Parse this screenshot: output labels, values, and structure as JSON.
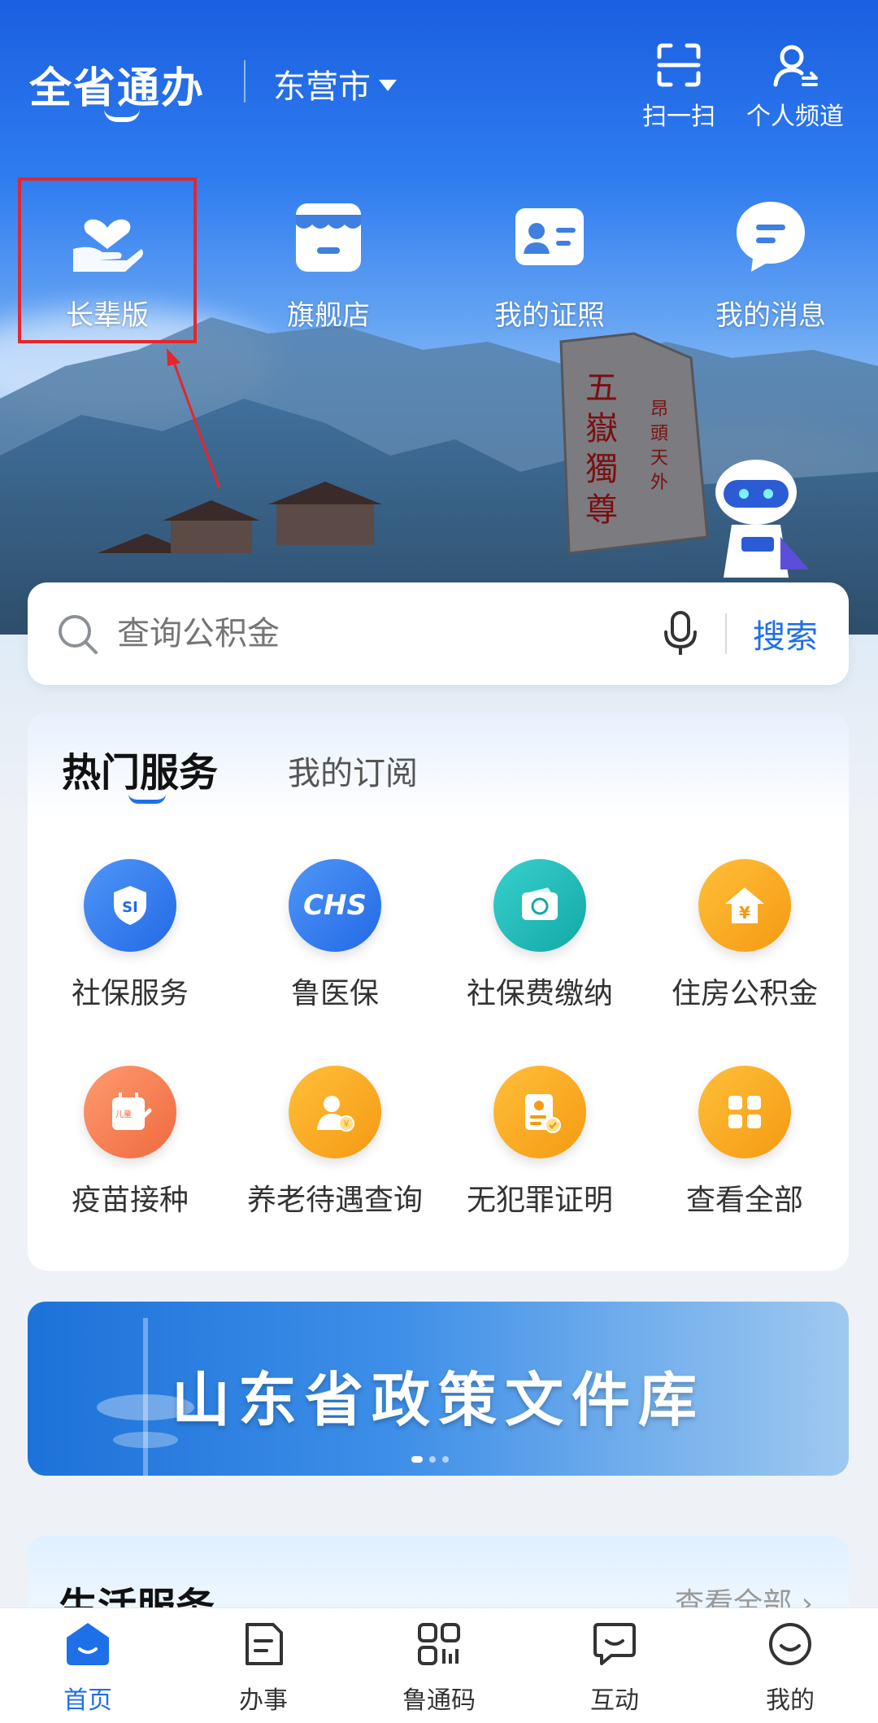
{
  "header": {
    "brand": "全省通办",
    "city": "东营市",
    "scan_label": "扫一扫",
    "personal_label": "个人频道"
  },
  "quick_entries": [
    {
      "label": "长辈版",
      "icon": "hand-heart-icon"
    },
    {
      "label": "旗舰店",
      "icon": "store-icon"
    },
    {
      "label": "我的证照",
      "icon": "id-card-icon"
    },
    {
      "label": "我的消息",
      "icon": "message-icon"
    }
  ],
  "search": {
    "placeholder": "查询公积金",
    "button": "搜索"
  },
  "services": {
    "tab_active": "热门服务",
    "tab_other": "我的订阅",
    "items": [
      {
        "label": "社保服务",
        "icon": "shield-si-icon",
        "color": "#2f7ef2"
      },
      {
        "label": "鲁医保",
        "icon": "chs-icon",
        "color": "#2f7ef2",
        "icon_text": "CHS"
      },
      {
        "label": "社保费缴纳",
        "icon": "si-card-icon",
        "color": "#1fb8b5"
      },
      {
        "label": "住房公积金",
        "icon": "house-yuan-icon",
        "color": "#f7a21a",
        "icon_text": "¥"
      },
      {
        "label": "疫苗接种",
        "icon": "vaccine-calendar-icon",
        "color": "#f57e4f",
        "icon_text": "儿童"
      },
      {
        "label": "养老待遇查询",
        "icon": "elder-pension-icon",
        "color": "#f7a21a",
        "icon_text": "¥"
      },
      {
        "label": "无犯罪证明",
        "icon": "certificate-icon",
        "color": "#f7a21a"
      },
      {
        "label": "查看全部",
        "icon": "grid-icon",
        "color": "#f7a21a"
      }
    ]
  },
  "banner": {
    "title": "山东省政策文件库"
  },
  "life": {
    "title": "生活服务",
    "more": "查看全部 ›"
  },
  "nav": [
    {
      "label": "首页",
      "icon": "home-icon",
      "active": true
    },
    {
      "label": "办事",
      "icon": "tasks-icon",
      "active": false
    },
    {
      "label": "鲁通码",
      "icon": "code-icon",
      "active": false
    },
    {
      "label": "互动",
      "icon": "chat-icon",
      "active": false
    },
    {
      "label": "我的",
      "icon": "profile-icon",
      "active": false
    }
  ],
  "colors": {
    "accent": "#1f6fe8",
    "highlight": "#e5262b"
  }
}
